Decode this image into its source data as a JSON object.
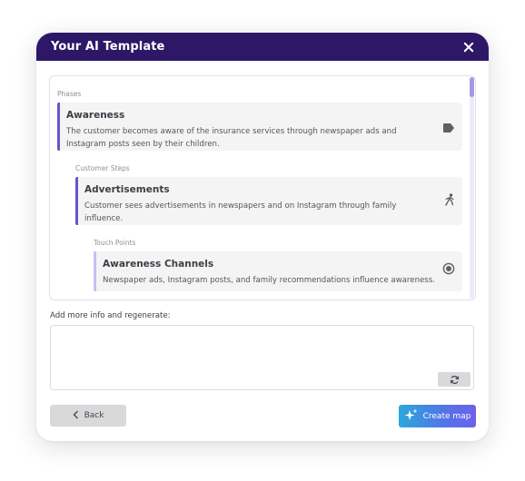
{
  "header": {
    "title": "Your AI Template"
  },
  "sections": {
    "phases_label": "Phases",
    "steps_label": "Customer Steps",
    "touch_label": "Touch Points"
  },
  "phase": {
    "title": "Awareness",
    "description": "The customer becomes aware of the insurance services through newspaper ads and Instagram posts seen by their children.",
    "icon": "tag-icon"
  },
  "step": {
    "title": "Advertisements",
    "description": "Customer sees advertisements in newspapers and on Instagram through family influence.",
    "icon": "walking-person-icon"
  },
  "touchpoint": {
    "title": "Awareness Channels",
    "description": "Newspaper ads, Instagram posts, and family recommendations influence awareness.",
    "icon": "radio-target-icon"
  },
  "regenerate": {
    "label": "Add more info and regenerate:",
    "value": ""
  },
  "actions": {
    "back_label": "Back",
    "create_label": "Create map"
  },
  "colors": {
    "header_bg": "#2d1766",
    "accent": "#6b53c9",
    "touchpoint_accent": "#c9bff0",
    "gradient_start": "#2aa8dc",
    "gradient_end": "#6a63ea"
  }
}
